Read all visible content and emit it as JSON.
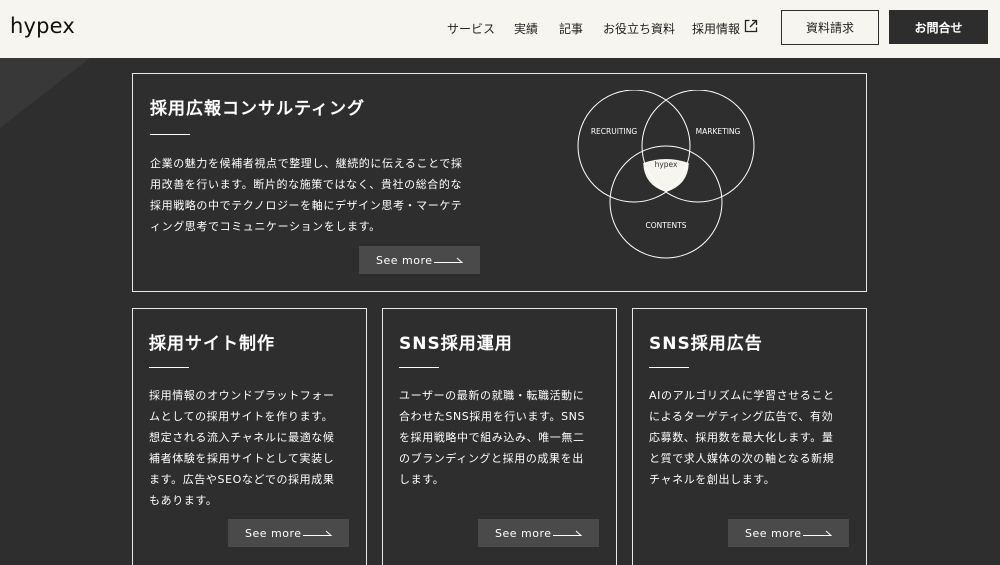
{
  "header": {
    "logo": "hypex",
    "nav": [
      "サービス",
      "実績",
      "記事",
      "お役立ち資料",
      "採用情報"
    ],
    "docs_button": "資料請求",
    "contact_button": "お問合せ"
  },
  "feature": {
    "title": "採用広報コンサルティング",
    "lines": [
      "企業の魅力を候補者視点で整理し、継続的に伝えることで採",
      "用改善を行います。断片的な施策ではなく、貴社の総合的な",
      "採用戦略の中でテクノロジーを軸にデザイン思考・マーケテ",
      "ィング思考でコミュニケーションをします。"
    ],
    "see_more": "See more",
    "venn": {
      "recruiting": "RECRUITING",
      "marketing": "MARKETING",
      "contents": "CONTENTS",
      "center": "hypex"
    }
  },
  "cards": [
    {
      "title": "採用サイト制作",
      "lines": [
        "採用情報のオウンドプラットフォー",
        "ムとしての採用サイトを作ります。",
        "想定される流入チャネルに最適な候",
        "補者体験を採用サイトとして実装し",
        "ます。広告やSEOなどでの採用成果",
        "もあります。"
      ],
      "see_more": "See more"
    },
    {
      "title": "SNS採用運用",
      "lines": [
        "ユーザーの最新の就職・転職活動に",
        "合わせたSNS採用を行います。SNS",
        "を採用戦略中で組み込み、唯一無二",
        "のブランディングと採用の成果を出",
        "します。"
      ],
      "see_more": "See more"
    },
    {
      "title": "SNS採用広告",
      "lines": [
        "AIのアルゴリズムに学習させること",
        "によるターゲティング広告で、有効",
        "応募数、採用数を最大化します。量",
        "と質で求人媒体の次の軸となる新規",
        "チャネルを創出します。"
      ],
      "see_more": "See more"
    }
  ]
}
